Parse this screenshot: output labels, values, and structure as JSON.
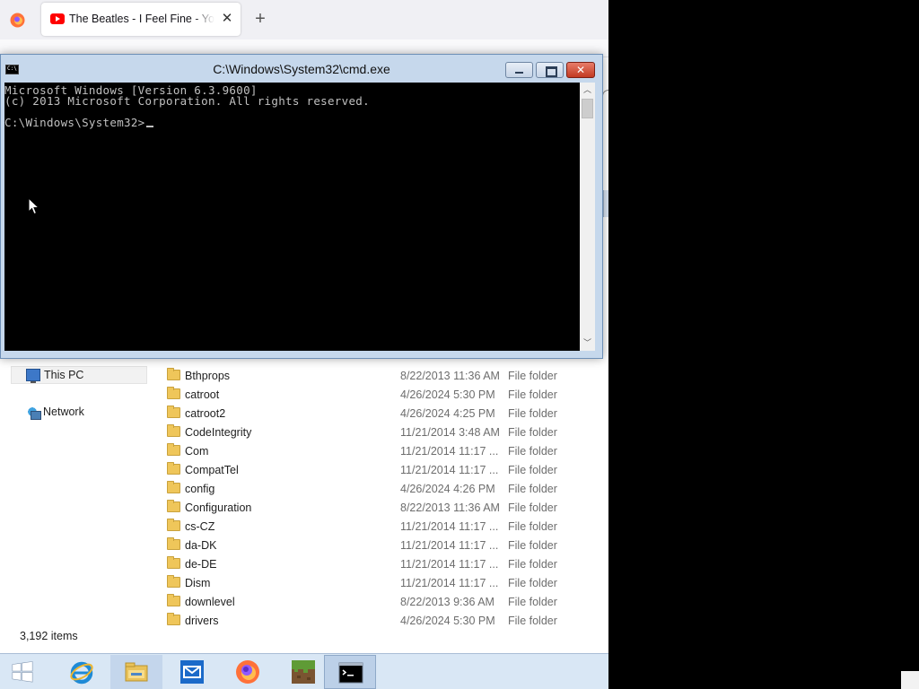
{
  "firefox": {
    "tab_title": "The Beatles - I Feel Fine - YouTube",
    "tab_close": "✕",
    "new_tab": "+"
  },
  "cmd": {
    "title": "C:\\Windows\\System32\\cmd.exe",
    "icon_text": "C:\\",
    "lines": [
      "Microsoft Windows [Version 6.3.9600]",
      "(c) 2013 Microsoft Corporation. All rights reserved.",
      "C:\\Windows\\System32>"
    ]
  },
  "explorer": {
    "nav_items": [
      {
        "label": "This PC",
        "icon": "computer-icon",
        "selected": true
      },
      {
        "label": "Network",
        "icon": "network-icon",
        "selected": false
      }
    ],
    "files": [
      {
        "name": "Bthprops",
        "date": "8/22/2013 11:36 AM",
        "type": "File folder"
      },
      {
        "name": "catroot",
        "date": "4/26/2024 5:30 PM",
        "type": "File folder"
      },
      {
        "name": "catroot2",
        "date": "4/26/2024 4:25 PM",
        "type": "File folder"
      },
      {
        "name": "CodeIntegrity",
        "date": "11/21/2014 3:48 AM",
        "type": "File folder"
      },
      {
        "name": "Com",
        "date": "11/21/2014 11:17 ...",
        "type": "File folder"
      },
      {
        "name": "CompatTel",
        "date": "11/21/2014 11:17 ...",
        "type": "File folder"
      },
      {
        "name": "config",
        "date": "4/26/2024 4:26 PM",
        "type": "File folder"
      },
      {
        "name": "Configuration",
        "date": "8/22/2013 11:36 AM",
        "type": "File folder"
      },
      {
        "name": "cs-CZ",
        "date": "11/21/2014 11:17 ...",
        "type": "File folder"
      },
      {
        "name": "da-DK",
        "date": "11/21/2014 11:17 ...",
        "type": "File folder"
      },
      {
        "name": "de-DE",
        "date": "11/21/2014 11:17 ...",
        "type": "File folder"
      },
      {
        "name": "Dism",
        "date": "11/21/2014 11:17 ...",
        "type": "File folder"
      },
      {
        "name": "downlevel",
        "date": "8/22/2013 9:36 AM",
        "type": "File folder"
      },
      {
        "name": "drivers",
        "date": "4/26/2024 5:30 PM",
        "type": "File folder"
      }
    ],
    "status": "3,192 items"
  },
  "taskbar": {
    "items": [
      {
        "name": "start-button",
        "icon": "windows-logo-icon",
        "state": "normal"
      },
      {
        "name": "taskbar-internet-explorer",
        "icon": "internet-explorer-icon",
        "state": "normal"
      },
      {
        "name": "taskbar-file-explorer",
        "icon": "file-explorer-icon",
        "state": "running"
      },
      {
        "name": "taskbar-mail",
        "icon": "mail-icon",
        "state": "normal"
      },
      {
        "name": "taskbar-firefox",
        "icon": "firefox-icon",
        "state": "normal"
      },
      {
        "name": "taskbar-minecraft",
        "icon": "minecraft-icon",
        "state": "normal"
      },
      {
        "name": "taskbar-command-prompt",
        "icon": "command-prompt-icon",
        "state": "active"
      }
    ]
  },
  "colors": {
    "console_bg": "#000000",
    "console_text": "#c0c0c0",
    "window_frame": "#c6d8ec",
    "taskbar": "#d9e7f5",
    "close_button": "#c23a22"
  }
}
